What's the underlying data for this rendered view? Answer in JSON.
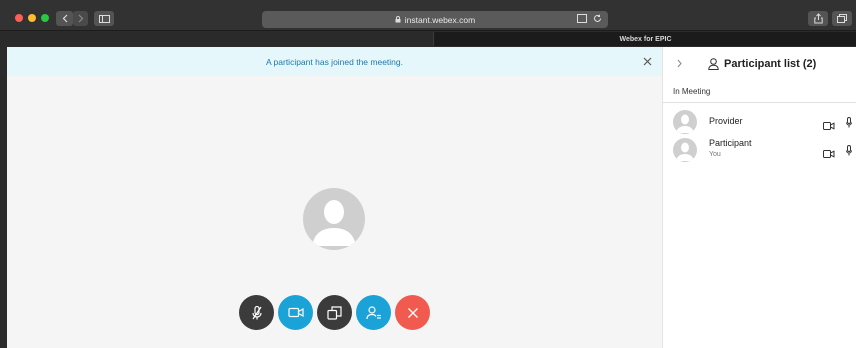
{
  "browser": {
    "url": "instant.webex.com",
    "active_tab_title": "Webex for EPIC"
  },
  "notification": {
    "message": "A participant has joined the meeting."
  },
  "participants_panel": {
    "title": "Participant list (2)",
    "section": "In Meeting",
    "participants": [
      {
        "name": "Provider",
        "subtitle": ""
      },
      {
        "name": "Participant",
        "subtitle": "You"
      }
    ]
  },
  "controls": {
    "mute": "microphone-muted-icon",
    "video": "video-camera-icon",
    "share": "share-screen-icon",
    "participants": "participants-icon",
    "leave": "leave-meeting-icon"
  },
  "colors": {
    "accent": "#1ba2d7",
    "leave": "#f05a4f",
    "notification_bg": "#e6f7fb",
    "notification_text": "#1f78a8"
  }
}
